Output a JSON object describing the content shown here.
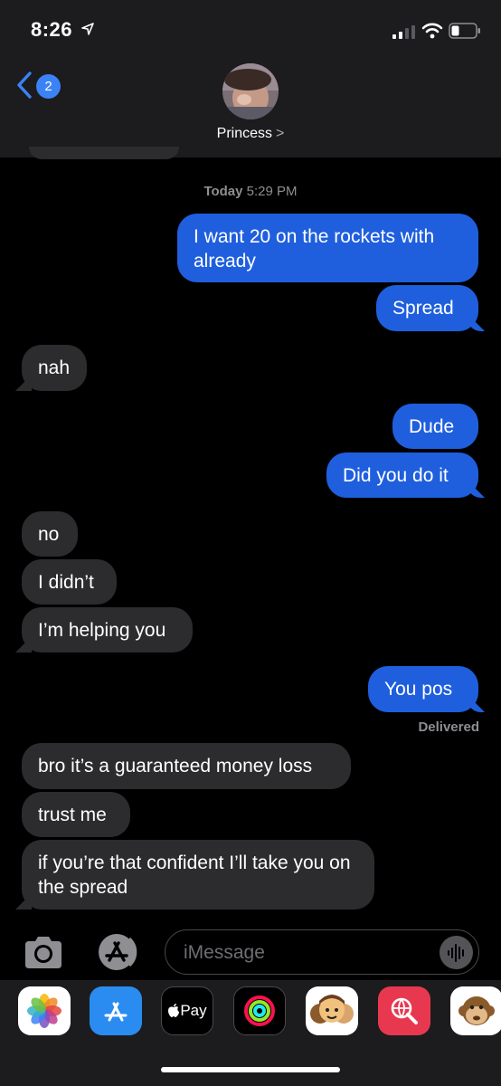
{
  "status_bar": {
    "time": "8:26"
  },
  "header": {
    "back_badge": "2",
    "contact_name": "Princess",
    "contact_chevron": ">"
  },
  "thread": {
    "timestamp_day": "Today",
    "timestamp_time": "5:29 PM",
    "messages": [
      {
        "from": "me",
        "text": "I want 20 on the rockets with already"
      },
      {
        "from": "me",
        "text": "Spread"
      },
      {
        "from": "them",
        "text": "nah"
      },
      {
        "from": "me",
        "text": "Dude"
      },
      {
        "from": "me",
        "text": "Did you do it"
      },
      {
        "from": "them",
        "text": "no"
      },
      {
        "from": "them",
        "text": "I didn’t"
      },
      {
        "from": "them",
        "text": "I’m helping you"
      },
      {
        "from": "me",
        "text": "You pos"
      },
      {
        "from": "them",
        "text": "bro it’s a guaranteed money loss"
      },
      {
        "from": "them",
        "text": "trust me"
      },
      {
        "from": "them",
        "text": "if you’re that confident I’ll take you on the spread"
      }
    ],
    "delivered_label": "Delivered"
  },
  "composer": {
    "placeholder": "iMessage"
  },
  "app_drawer": {
    "apps": [
      {
        "name": "Photos",
        "icon": "photos-icon"
      },
      {
        "name": "App Store",
        "icon": "app-store-icon"
      },
      {
        "name": "Apple Pay",
        "label": "Pay",
        "icon": "apple-pay-icon"
      },
      {
        "name": "Activity",
        "icon": "activity-rings-icon"
      },
      {
        "name": "Memoji",
        "icon": "memoji-icon"
      },
      {
        "name": "Search Images",
        "icon": "globe-search-icon"
      },
      {
        "name": "Animoji",
        "icon": "monkey-icon"
      }
    ]
  },
  "colors": {
    "outgoing": "#1f5fde",
    "incoming": "#2c2c2e",
    "background": "#000000",
    "header": "#1c1c1e"
  }
}
